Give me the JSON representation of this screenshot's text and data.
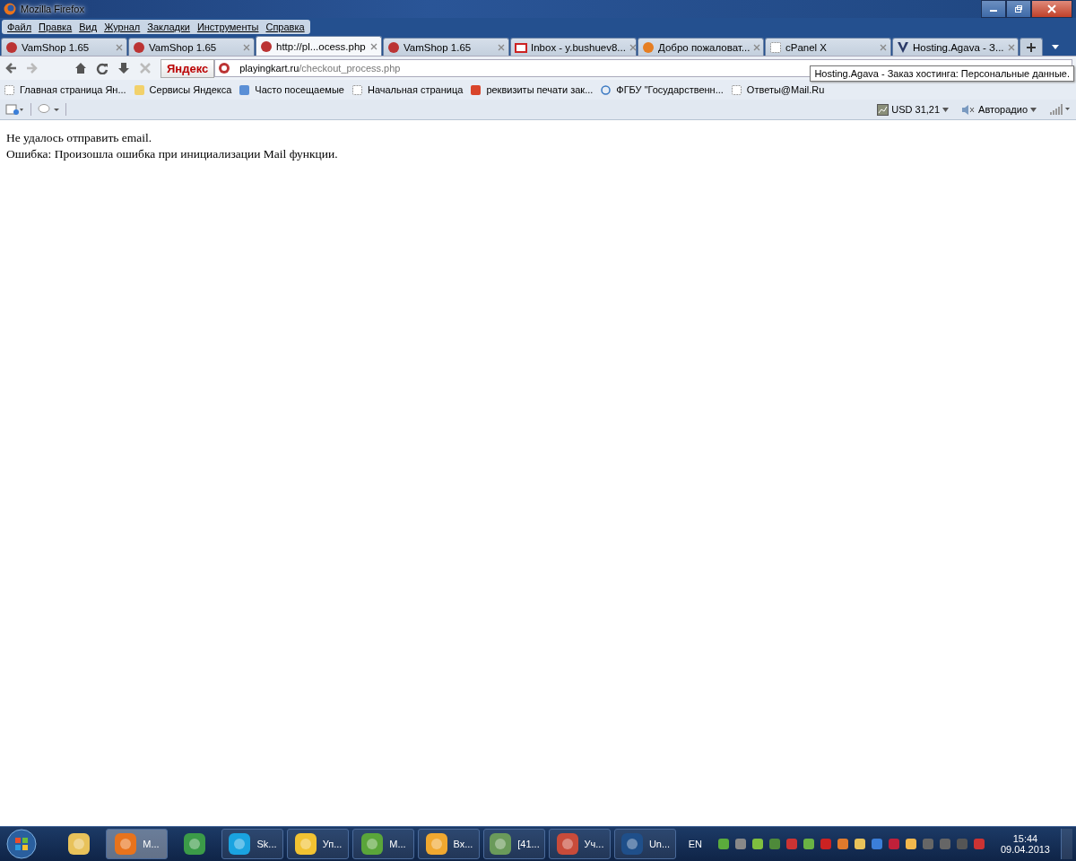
{
  "window": {
    "title": "Mozilla Firefox"
  },
  "menu": [
    "Файл",
    "Правка",
    "Вид",
    "Журнал",
    "Закладки",
    "Инструменты",
    "Справка"
  ],
  "tabs": [
    {
      "label": "VamShop 1.65",
      "kind": "site",
      "selected": false
    },
    {
      "label": "VamShop 1.65",
      "kind": "site",
      "selected": false
    },
    {
      "label": "http://pl...ocess.php",
      "kind": "site",
      "selected": true
    },
    {
      "label": "VamShop 1.65",
      "kind": "site",
      "selected": false
    },
    {
      "label": "Inbox - y.bushuev8...",
      "kind": "mail",
      "selected": false
    },
    {
      "label": "Добро пожаловат...",
      "kind": "globe",
      "selected": false
    },
    {
      "label": "cPanel X",
      "kind": "blank",
      "selected": false
    },
    {
      "label": "Hosting.Agava - З...",
      "kind": "letter",
      "selected": false
    }
  ],
  "navbar": {
    "search_logo": "Яндекс",
    "url_host": "playingkart.ru",
    "url_path": "/checkout_process.php"
  },
  "tooltip": "Hosting.Agava - Заказ хостинга: Персональные данные.",
  "bookmarks": [
    {
      "label": "Главная страница Ян...",
      "kind": "blank"
    },
    {
      "label": "Сервисы Яндекса",
      "kind": "folder"
    },
    {
      "label": "Часто посещаемые",
      "kind": "search"
    },
    {
      "label": "Начальная страница",
      "kind": "blank"
    },
    {
      "label": "реквизиты печати зак...",
      "kind": "stamp"
    },
    {
      "label": "ФГБУ \"Государственн...",
      "kind": "swirl"
    },
    {
      "label": "Ответы@Mail.Ru",
      "kind": "blank"
    }
  ],
  "addon_bar": {
    "currency": "USD 31,21",
    "radio": "Авторадио"
  },
  "content": [
    "Не удалось отправить email.",
    "Ошибка: Произошла ошибка при инициализации Mail функции."
  ],
  "taskbar": {
    "apps": [
      {
        "kind": "folder",
        "active": false
      },
      {
        "label": "M...",
        "kind": "firefox",
        "active": true
      },
      {
        "kind": "chrome",
        "active": false
      },
      {
        "label": "Sk...",
        "kind": "skype",
        "active": false
      },
      {
        "label": "Уп...",
        "kind": "onec",
        "active": false
      },
      {
        "label": "M...",
        "kind": "check",
        "active": false
      },
      {
        "label": "Вх...",
        "kind": "outlook",
        "active": false
      },
      {
        "label": "[41...",
        "kind": "phone",
        "active": false
      },
      {
        "label": "Уч...",
        "kind": "people",
        "active": false
      },
      {
        "label": "Un...",
        "kind": "ps",
        "active": false
      }
    ],
    "language": "EN",
    "time": "15:44",
    "date": "09.04.2013"
  }
}
